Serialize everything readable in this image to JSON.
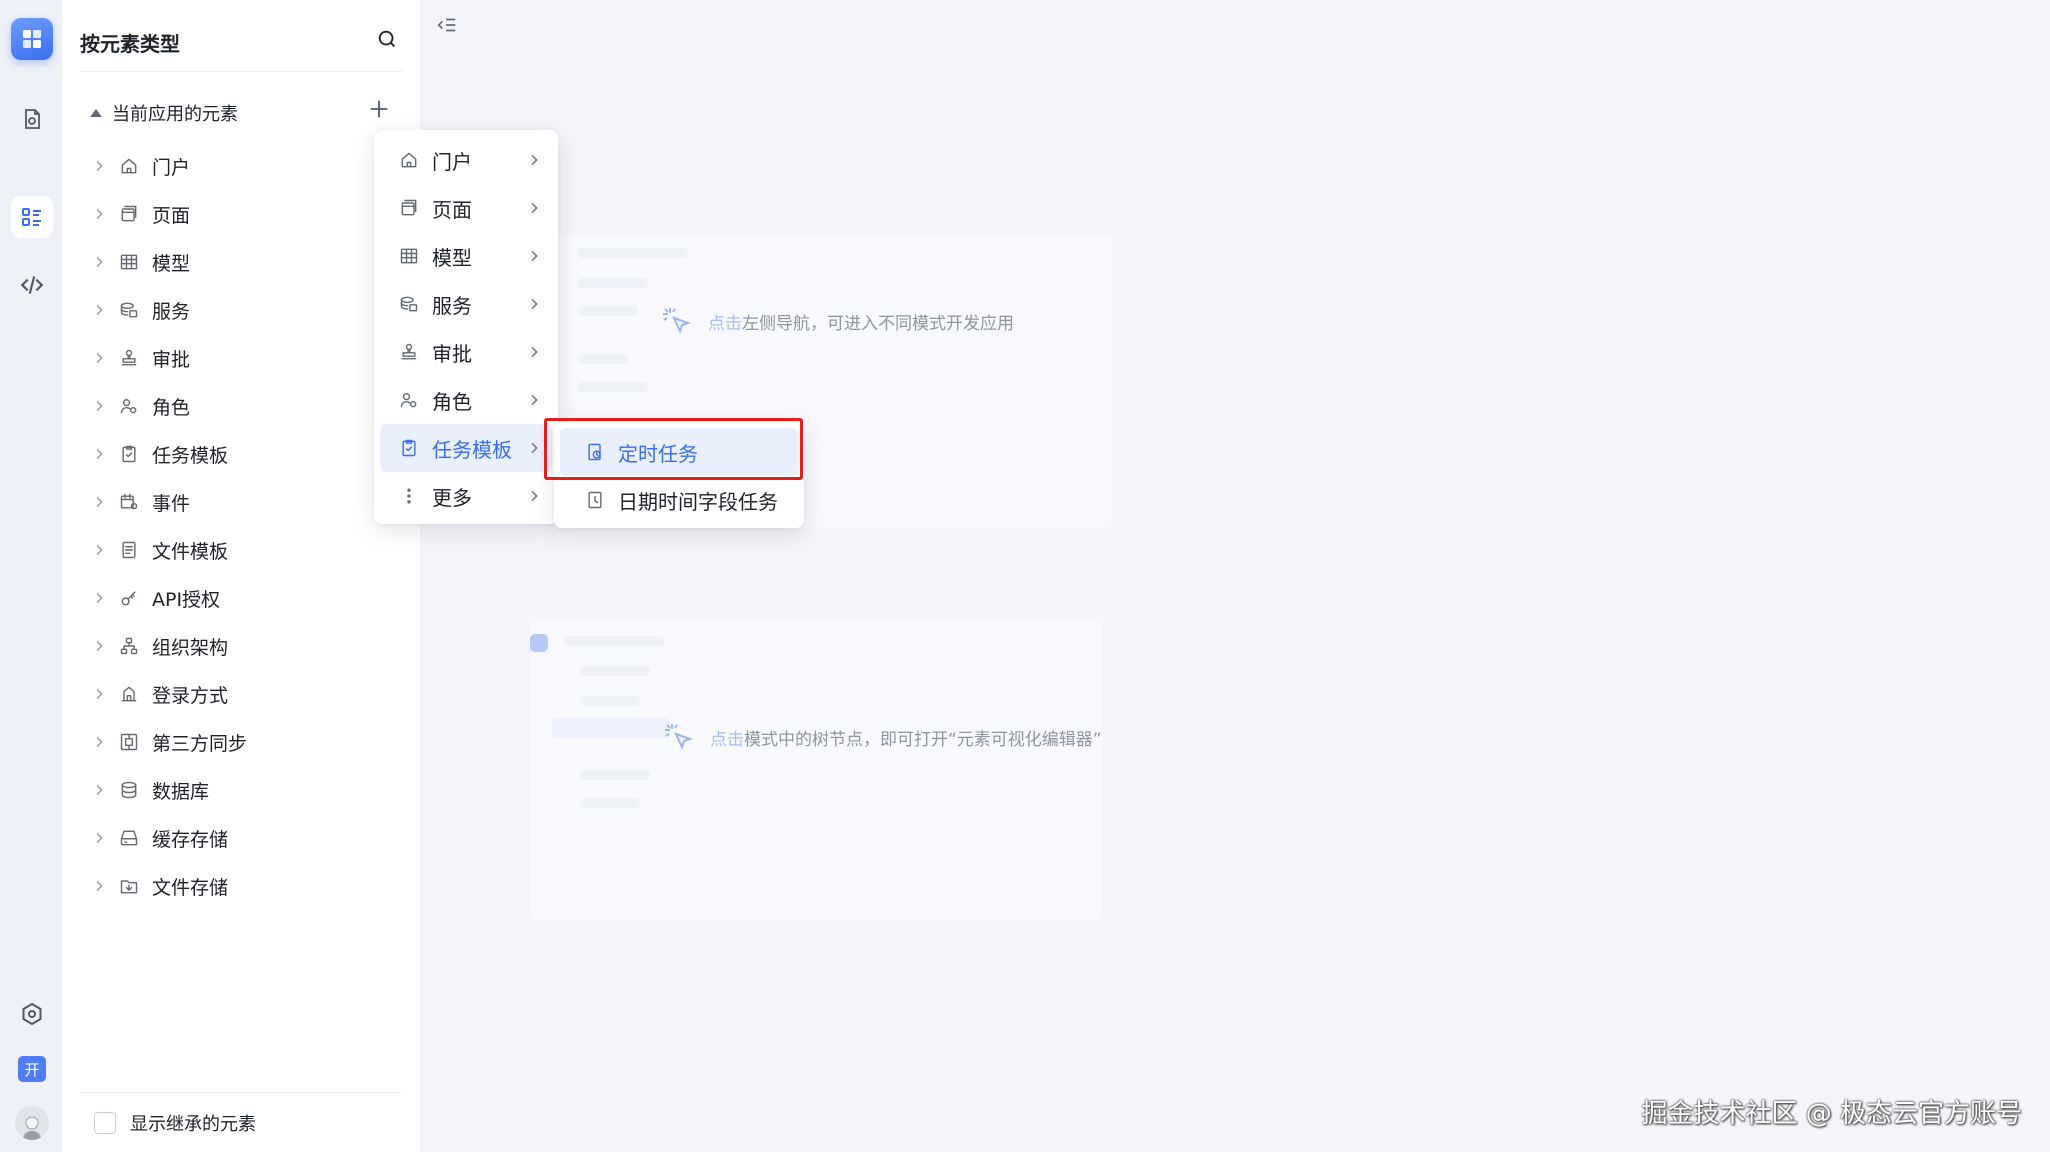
{
  "panel": {
    "title": "按元素类型",
    "group_label": "当前应用的元素",
    "items": [
      {
        "label": "门户",
        "icon": "home-icon"
      },
      {
        "label": "页面",
        "icon": "page-icon"
      },
      {
        "label": "模型",
        "icon": "table-icon"
      },
      {
        "label": "服务",
        "icon": "service-icon"
      },
      {
        "label": "审批",
        "icon": "stamp-icon"
      },
      {
        "label": "角色",
        "icon": "role-icon"
      },
      {
        "label": "任务模板",
        "icon": "task-icon"
      },
      {
        "label": "事件",
        "icon": "event-icon"
      },
      {
        "label": "文件模板",
        "icon": "file-template-icon"
      },
      {
        "label": "API授权",
        "icon": "key-icon"
      },
      {
        "label": "组织架构",
        "icon": "org-icon"
      },
      {
        "label": "登录方式",
        "icon": "login-icon"
      },
      {
        "label": "第三方同步",
        "icon": "sync-icon"
      },
      {
        "label": "数据库",
        "icon": "database-icon"
      },
      {
        "label": "缓存存储",
        "icon": "cache-icon"
      },
      {
        "label": "文件存储",
        "icon": "file-storage-icon"
      }
    ],
    "footer_checkbox_label": "显示继承的元素",
    "footer_checked": false
  },
  "menu": {
    "items": [
      {
        "label": "门户",
        "icon": "home-icon"
      },
      {
        "label": "页面",
        "icon": "page-icon"
      },
      {
        "label": "模型",
        "icon": "table-icon"
      },
      {
        "label": "服务",
        "icon": "service-icon"
      },
      {
        "label": "审批",
        "icon": "stamp-icon"
      },
      {
        "label": "角色",
        "icon": "role-icon"
      },
      {
        "label": "任务模板",
        "icon": "task-icon",
        "active": true
      },
      {
        "label": "更多",
        "icon": "more-vertical-icon"
      }
    ],
    "submenu": [
      {
        "label": "定时任务",
        "icon": "scheduled-task-icon",
        "active": true
      },
      {
        "label": "日期时间字段任务",
        "icon": "datetime-task-icon"
      }
    ]
  },
  "workspace": {
    "hint1": {
      "highlight": "点击",
      "rest": "左侧导航，可进入不同模式开发应用"
    },
    "hint2": {
      "highlight": "点击",
      "rest": "模式中的树节点，即可打开“元素可视化编辑器”"
    }
  },
  "rail": {
    "avatar_initial": "开"
  },
  "watermark": "掘金技术社区 @ 极态云官方账号",
  "colors": {
    "accent": "#3b6df2",
    "highlight_border": "#e0201b",
    "active_bg": "#e9effd"
  }
}
